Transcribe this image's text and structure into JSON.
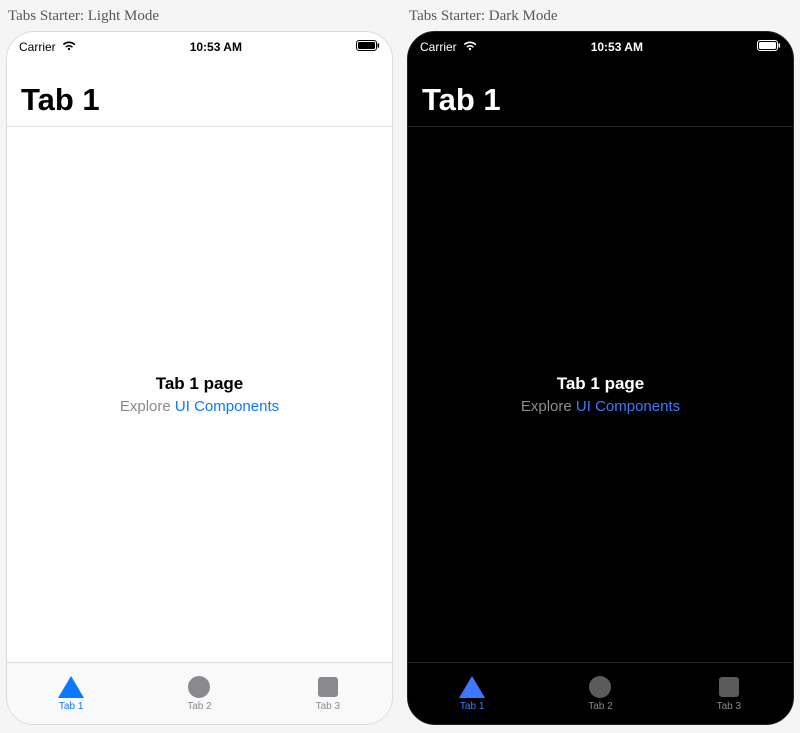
{
  "captions": {
    "light": "Tabs Starter: Light Mode",
    "dark": "Tabs Starter: Dark Mode"
  },
  "status": {
    "carrier": "Carrier",
    "time": "10:53 AM"
  },
  "header": {
    "title": "Tab 1"
  },
  "content": {
    "title": "Tab 1 page",
    "explore_prefix": "Explore ",
    "link_text": "UI Components"
  },
  "tabs": [
    {
      "label": "Tab 1",
      "icon": "triangle-icon",
      "active": true
    },
    {
      "label": "Tab 2",
      "icon": "circle-icon",
      "active": false
    },
    {
      "label": "Tab 3",
      "icon": "square-icon",
      "active": false
    }
  ],
  "colors": {
    "accent_light": "#0b78ff",
    "accent_dark": "#3f78ff",
    "inactive": "#8a8a8e"
  }
}
